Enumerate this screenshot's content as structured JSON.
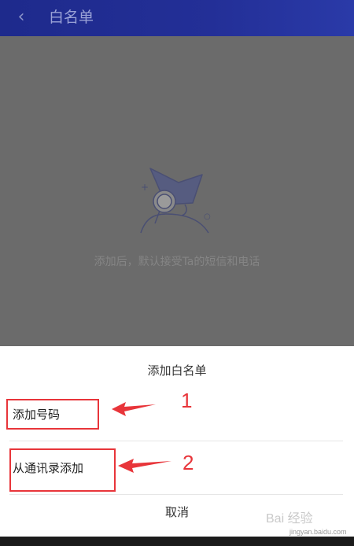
{
  "header": {
    "title": "白名单",
    "back_icon": "chevron-left-icon",
    "background": "#1e2a8c"
  },
  "empty_state": {
    "illustration": "detective-magnifier-illustration",
    "text": "添加后，默认接受Ta的短信和电话"
  },
  "sheet": {
    "title": "添加白名单",
    "options": [
      {
        "label": "添加号码"
      },
      {
        "label": "从通讯录添加"
      }
    ],
    "cancel_label": "取消"
  },
  "annotations": {
    "numbers": [
      "1",
      "2"
    ],
    "color": "#e8353a"
  },
  "watermark": {
    "text": "Bai 经验",
    "sub": "jingyan.baidu.com"
  }
}
